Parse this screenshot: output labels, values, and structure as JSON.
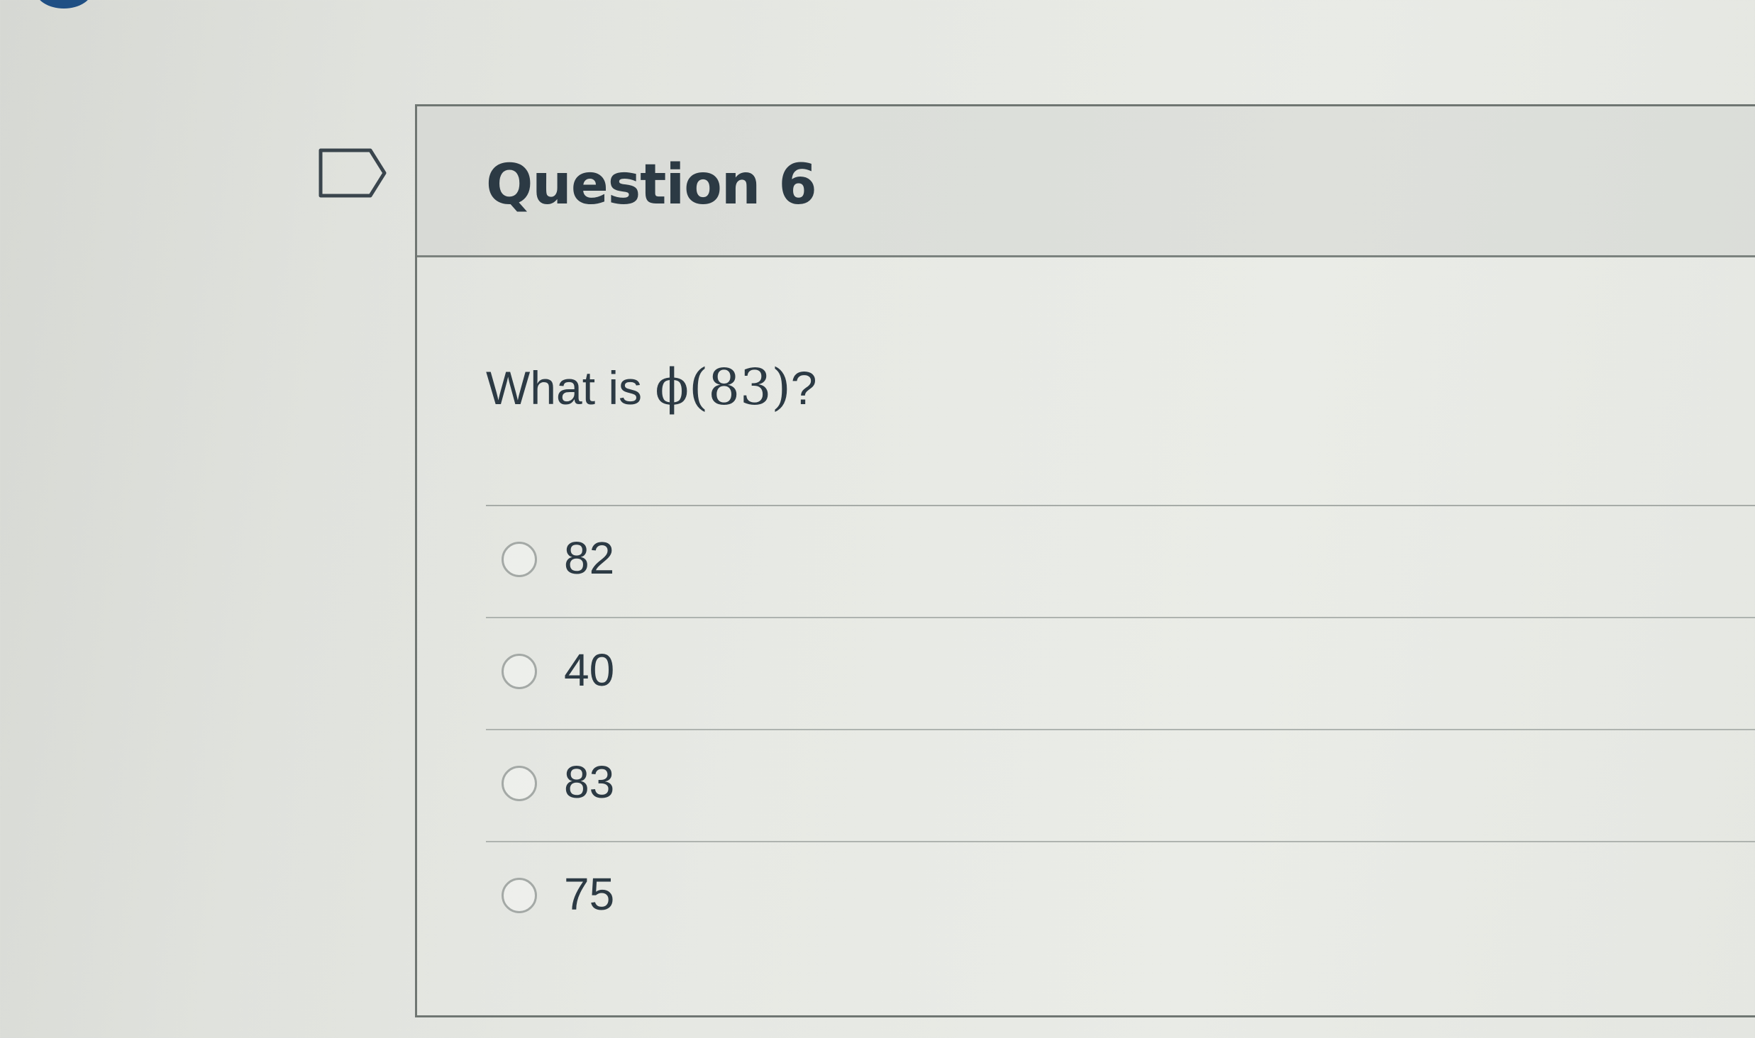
{
  "question": {
    "title": "Question 6",
    "prompt_prefix": "What is ",
    "prompt_math": "ϕ(83)",
    "prompt_suffix": "?"
  },
  "answers": [
    {
      "label": "82"
    },
    {
      "label": "40"
    },
    {
      "label": "83"
    },
    {
      "label": "75"
    }
  ],
  "colors": {
    "text": "#2d3b45",
    "border": "#6f7672",
    "badge": "#1f4f84"
  }
}
